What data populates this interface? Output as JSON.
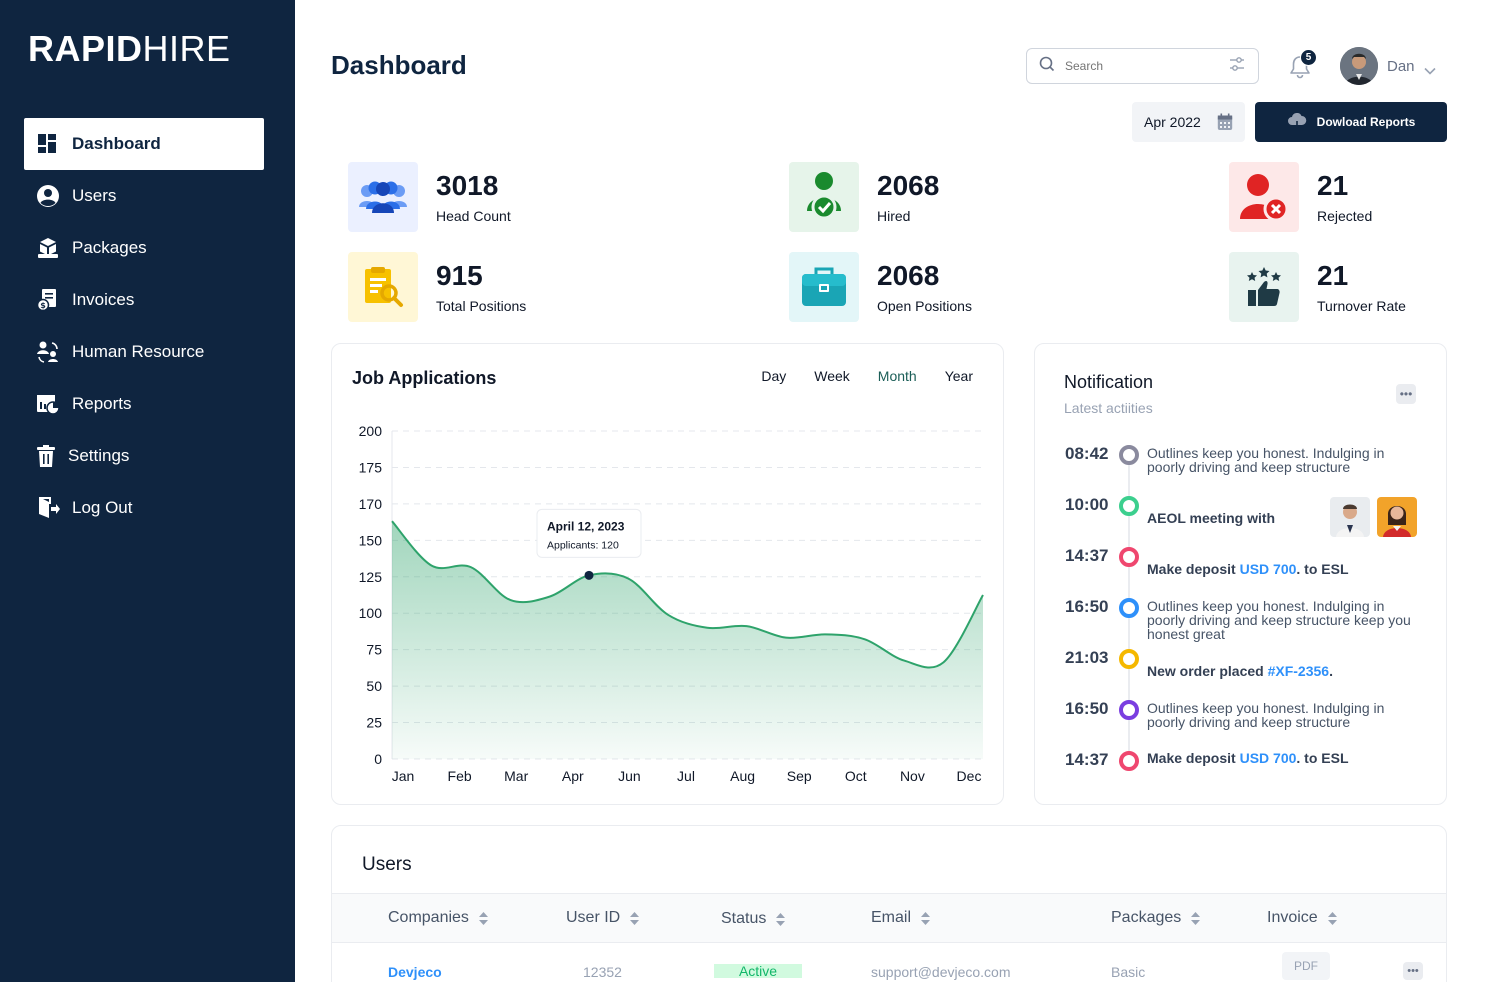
{
  "brand": {
    "bold": "RAPID",
    "thin": "HIRE"
  },
  "sidebar": {
    "items": [
      {
        "label": "Dashboard",
        "icon": "dashboard-icon",
        "active": true
      },
      {
        "label": "Users",
        "icon": "user-icon"
      },
      {
        "label": "Packages",
        "icon": "packages-icon"
      },
      {
        "label": "Invoices",
        "icon": "invoice-icon"
      },
      {
        "label": "Human Resource",
        "icon": "human-resource-icon"
      },
      {
        "label": "Reports",
        "icon": "reports-icon"
      },
      {
        "label": "Settings",
        "icon": "trash-icon"
      },
      {
        "label": "Log Out",
        "icon": "logout-icon"
      }
    ]
  },
  "header": {
    "title": "Dashboard",
    "search_placeholder": "Search",
    "notification_count": "5",
    "user_name": "Dan",
    "date": "Apr 2022",
    "download_label": "Dowload Reports"
  },
  "stats": [
    {
      "value": "3018",
      "label": "Head Count",
      "color": "#ebf0ff"
    },
    {
      "value": "2068",
      "label": "Hired",
      "color": "#e6f4ea"
    },
    {
      "value": "21",
      "label": "Rejected",
      "color": "#fde8e8"
    },
    {
      "value": "915",
      "label": "Total Positions",
      "color": "#fff7d6"
    },
    {
      "value": "2068",
      "label": "Open Positions",
      "color": "#e3f6f8"
    },
    {
      "value": "21",
      "label": "Turnover Rate",
      "color": "#e8f3ef"
    }
  ],
  "job_applications": {
    "title": "Job Applications",
    "tabs": [
      "Day",
      "Week",
      "Month",
      "Year"
    ],
    "selected_tab": "Month",
    "tooltip": {
      "date": "April 12, 2023",
      "text": "Applicants: 120"
    }
  },
  "chart_data": {
    "type": "area",
    "title": "Job Applications",
    "x": [
      "Jan",
      "Feb",
      "Mar",
      "Apr",
      "Jun",
      "Jul",
      "Aug",
      "Sep",
      "Oct",
      "Nov",
      "Dec"
    ],
    "y_ticks": [
      "200",
      "175",
      "170",
      "150",
      "125",
      "100",
      "75",
      "50",
      "25",
      "0"
    ],
    "series": [
      {
        "values": [
          145,
          118,
          117,
          97,
          99,
          112,
          110,
          88,
          80,
          81,
          74,
          76,
          73,
          60,
          59,
          100
        ]
      }
    ],
    "ylim": [
      0,
      200
    ],
    "grid": true,
    "color": "#2ea36b"
  },
  "notifications": {
    "title": "Notification",
    "subtitle": "Latest actiities",
    "items": [
      {
        "time": "08:42",
        "text": "Outlines keep you honest. Indulging in poorly driving and keep structure",
        "color": "#8a8a9e"
      },
      {
        "time": "10:00",
        "text": "AEOL meeting with",
        "color": "#3ccf8e"
      },
      {
        "time": "14:37",
        "pre": "Make deposit ",
        "hl": "USD 700",
        "post": ". to ESL",
        "color": "#ef476f"
      },
      {
        "time": "16:50",
        "text": "Outlines keep you honest. Indulging in poorly driving and keep structure keep you honest great",
        "color": "#2e90fa"
      },
      {
        "time": "21:03",
        "pre": "New order placed ",
        "hl": "#XF-2356",
        "post": ".",
        "color": "#f5b800"
      },
      {
        "time": "16:50",
        "text": "Outlines keep you honest. Indulging in poorly driving and keep structure",
        "color": "#7a3ee0"
      },
      {
        "time": "14:37",
        "pre": "Make deposit ",
        "hl": "USD 700",
        "post": ". to ESL",
        "color": "#ef476f"
      }
    ]
  },
  "users": {
    "title": "Users",
    "columns": [
      "Companies",
      "User ID",
      "Status",
      "Email",
      "Packages",
      "Invoice"
    ],
    "rows": [
      {
        "company": "Devjeco",
        "id": "12352",
        "status": "Active",
        "email": "support@devjeco.com",
        "package": "Basic",
        "invoice": "PDF"
      }
    ]
  }
}
